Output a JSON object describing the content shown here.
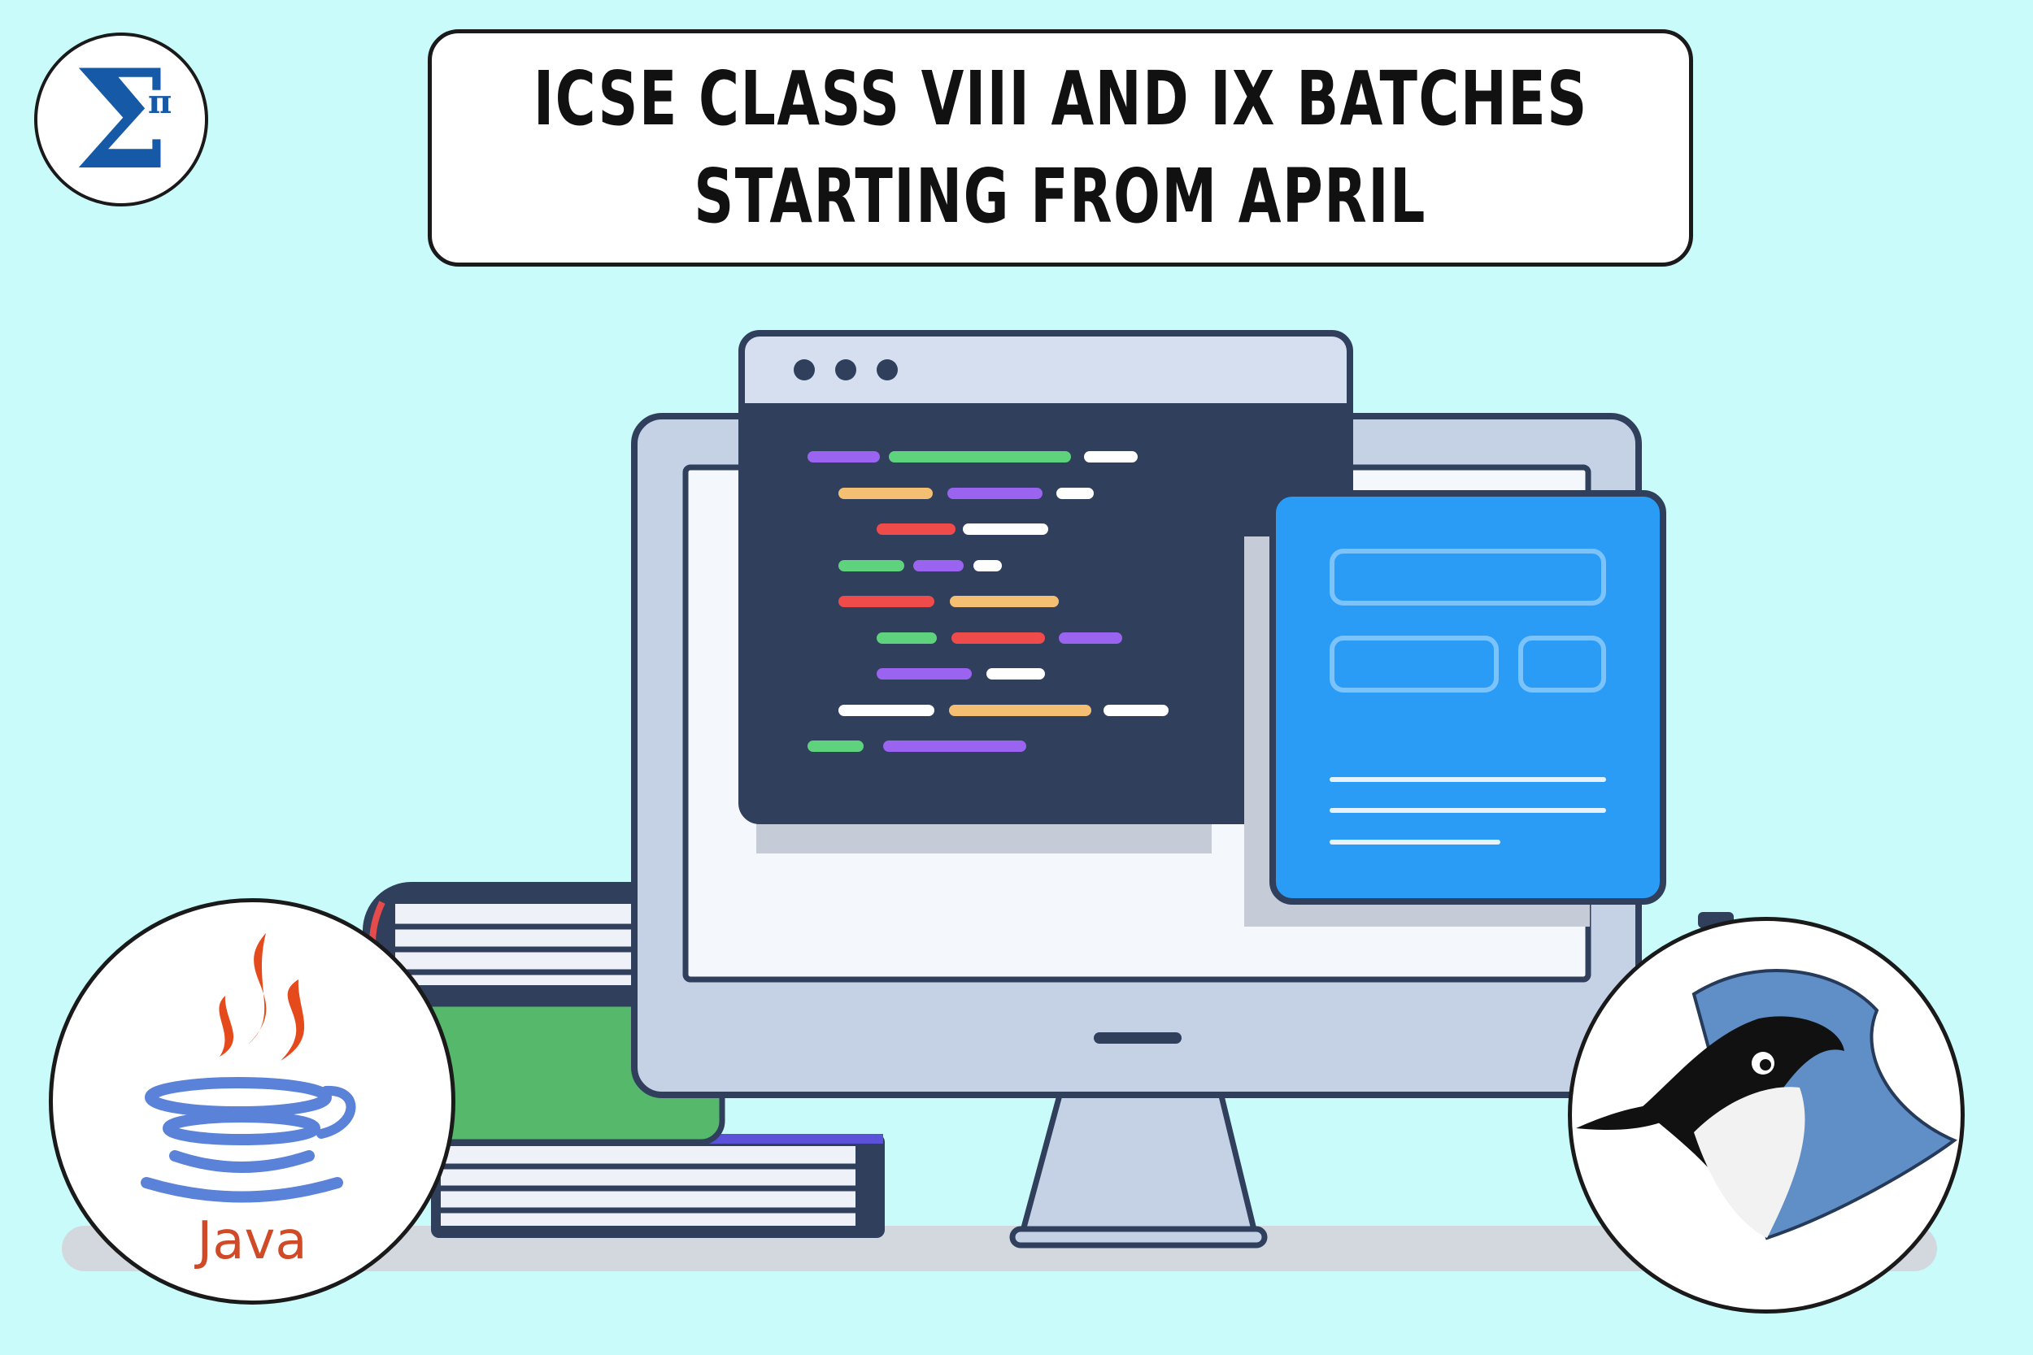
{
  "logo": {
    "symbol": "Σ",
    "superscript": "π"
  },
  "title": {
    "line1": "ICSE CLASS VIII AND IX BATCHES",
    "line2": "STARTING FROM APRIL"
  },
  "java_badge": {
    "label": "Java"
  },
  "colors": {
    "background": "#c9fbfb",
    "logo_blue": "#1659a6",
    "editor_dark": "#2f3f5c",
    "form_blue": "#2b9cf6",
    "monitor_frame": "#c5d2e6",
    "java_red": "#e54a1c",
    "java_blue": "#5a82d8",
    "bluej_blue": "#5f8fc6"
  },
  "icons": [
    "sigma-pi-logo-icon",
    "java-cup-icon",
    "bluej-bird-icon",
    "monitor-icon",
    "books-icon"
  ]
}
